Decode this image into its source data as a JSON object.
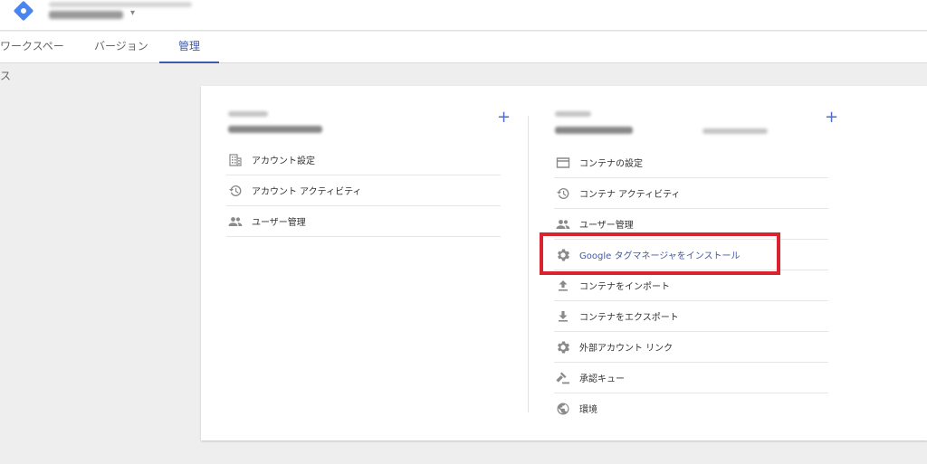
{
  "header": {
    "logo_icon": "tag-manager-logo-icon",
    "caret": "▾"
  },
  "tabs": [
    {
      "label": "ワークスペース"
    },
    {
      "label": "バージョン"
    },
    {
      "label": "管理"
    }
  ],
  "account": {
    "add_label": "+",
    "items": [
      {
        "icon": "building-icon",
        "label": "アカウント設定"
      },
      {
        "icon": "history-icon",
        "label": "アカウント アクティビティ"
      },
      {
        "icon": "people-icon",
        "label": "ユーザー管理"
      }
    ]
  },
  "container": {
    "add_label": "+",
    "items": [
      {
        "icon": "window-icon",
        "label": "コンテナの設定"
      },
      {
        "icon": "history-icon",
        "label": "コンテナ アクティビティ"
      },
      {
        "icon": "people-icon",
        "label": "ユーザー管理"
      },
      {
        "icon": "gear-icon",
        "label": "Google タグマネージャをインストール"
      },
      {
        "icon": "upload-icon",
        "label": "コンテナをインポート"
      },
      {
        "icon": "download-icon",
        "label": "コンテナをエクスポート"
      },
      {
        "icon": "gear-icon",
        "label": "外部アカウント リンク"
      },
      {
        "icon": "gavel-icon",
        "label": "承認キュー"
      },
      {
        "icon": "globe-icon",
        "label": "環境"
      }
    ]
  },
  "colors": {
    "accent": "#3f5ba9",
    "highlight": "#d9232f"
  }
}
